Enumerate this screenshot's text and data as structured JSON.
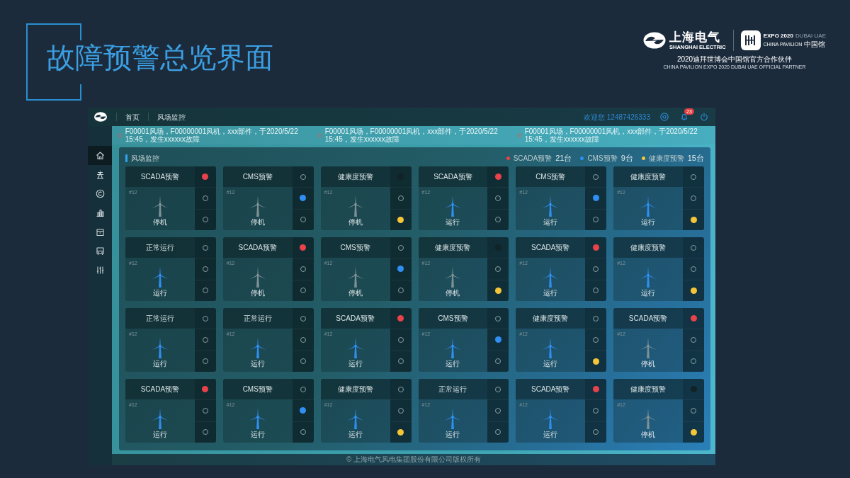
{
  "slide_title": "故障预警总览界面",
  "partner": {
    "brand_cn": "上海电气",
    "brand_en": "SHANGHAI ELECTRIC",
    "expo": "EXPO 2020",
    "expo_place": "DUBAI UAE",
    "pavilion_en": "CHINA PAVILION",
    "pavilion_cn": "中国馆",
    "caption_cn": "2020迪拜世博会中国馆官方合作伙伴",
    "caption_en": "CHINA PAVILION EXPO 2020 DUBAI UAE OFFICIAL PARTNER"
  },
  "app": {
    "nav": [
      "首页",
      "风场监控"
    ],
    "welcome": "欢迎您 12487426333",
    "notification_count": "23",
    "ticker": [
      "F00001风场，F00000001风机，xxx部件，于2020/5/22 15:45，发生xxxxxx故障",
      "F00001风场，F00000001风机，xxx部件，于2020/5/22 15:45，发生xxxxxx故障",
      "F00001风场，F00000001风机，xxx部件，于2020/5/22 15:45，发生xxxxxx故障"
    ],
    "sidebar": [
      {
        "selected": true
      },
      {
        "selected": false
      },
      {
        "selected": false
      },
      {
        "selected": false
      },
      {
        "selected": false
      },
      {
        "selected": false
      },
      {
        "selected": false
      }
    ],
    "panel": {
      "title": "风场监控",
      "legend": [
        {
          "label": "SCADA预警",
          "count": "21台",
          "color": "#e8424a"
        },
        {
          "label": "CMS预警",
          "count": "9台",
          "color": "#2f8ff2"
        },
        {
          "label": "健康度预警",
          "count": "15台",
          "color": "#f5c537"
        }
      ]
    },
    "turbines": [
      {
        "title": "SCADA预警",
        "number": "#12",
        "status": "停机",
        "running": false,
        "alerts": [
          {
            "on": true,
            "dimmed": false
          },
          {
            "on": false,
            "dimmed": false
          },
          {
            "on": false,
            "dimmed": false
          }
        ]
      },
      {
        "title": "CMS预警",
        "number": "#12",
        "status": "停机",
        "running": false,
        "alerts": [
          {
            "on": false,
            "dimmed": false
          },
          {
            "on": true,
            "dimmed": false
          },
          {
            "on": false,
            "dimmed": false
          }
        ]
      },
      {
        "title": "健康度预警",
        "number": "#12",
        "status": "停机",
        "running": false,
        "alerts": [
          {
            "on": false,
            "dimmed": true
          },
          {
            "on": false,
            "dimmed": false
          },
          {
            "on": true,
            "dimmed": false
          }
        ]
      },
      {
        "title": "SCADA预警",
        "number": "#12",
        "status": "运行",
        "running": true,
        "alerts": [
          {
            "on": true,
            "dimmed": false
          },
          {
            "on": false,
            "dimmed": false
          },
          {
            "on": false,
            "dimmed": false
          }
        ]
      },
      {
        "title": "CMS预警",
        "number": "#12",
        "status": "运行",
        "running": true,
        "alerts": [
          {
            "on": false,
            "dimmed": false
          },
          {
            "on": true,
            "dimmed": false
          },
          {
            "on": false,
            "dimmed": false
          }
        ]
      },
      {
        "title": "健康度预警",
        "number": "#12",
        "status": "运行",
        "running": true,
        "alerts": [
          {
            "on": false,
            "dimmed": false
          },
          {
            "on": false,
            "dimmed": false
          },
          {
            "on": true,
            "dimmed": false
          }
        ]
      },
      {
        "title": "正常运行",
        "number": "#12",
        "status": "运行",
        "running": true,
        "alerts": [
          {
            "on": false,
            "dimmed": false
          },
          {
            "on": false,
            "dimmed": false
          },
          {
            "on": false,
            "dimmed": false
          }
        ]
      },
      {
        "title": "SCADA预警",
        "number": "#12",
        "status": "停机",
        "running": false,
        "alerts": [
          {
            "on": true,
            "dimmed": false
          },
          {
            "on": false,
            "dimmed": false
          },
          {
            "on": false,
            "dimmed": false
          }
        ]
      },
      {
        "title": "CMS预警",
        "number": "#12",
        "status": "停机",
        "running": false,
        "alerts": [
          {
            "on": false,
            "dimmed": false
          },
          {
            "on": true,
            "dimmed": false
          },
          {
            "on": false,
            "dimmed": false
          }
        ]
      },
      {
        "title": "健康度预警",
        "number": "#12",
        "status": "停机",
        "running": false,
        "alerts": [
          {
            "on": false,
            "dimmed": true
          },
          {
            "on": false,
            "dimmed": false
          },
          {
            "on": true,
            "dimmed": false
          }
        ]
      },
      {
        "title": "SCADA预警",
        "number": "#12",
        "status": "运行",
        "running": true,
        "alerts": [
          {
            "on": true,
            "dimmed": false
          },
          {
            "on": false,
            "dimmed": false
          },
          {
            "on": false,
            "dimmed": false
          }
        ]
      },
      {
        "title": "健康度预警",
        "number": "#12",
        "status": "运行",
        "running": true,
        "alerts": [
          {
            "on": false,
            "dimmed": false
          },
          {
            "on": false,
            "dimmed": false
          },
          {
            "on": true,
            "dimmed": false
          }
        ]
      },
      {
        "title": "正常运行",
        "number": "#12",
        "status": "运行",
        "running": true,
        "alerts": [
          {
            "on": false,
            "dimmed": false
          },
          {
            "on": false,
            "dimmed": false
          },
          {
            "on": false,
            "dimmed": false
          }
        ]
      },
      {
        "title": "正常运行",
        "number": "#12",
        "status": "运行",
        "running": true,
        "alerts": [
          {
            "on": false,
            "dimmed": false
          },
          {
            "on": false,
            "dimmed": false
          },
          {
            "on": false,
            "dimmed": false
          }
        ]
      },
      {
        "title": "SCADA预警",
        "number": "#12",
        "status": "运行",
        "running": true,
        "alerts": [
          {
            "on": true,
            "dimmed": false
          },
          {
            "on": false,
            "dimmed": false
          },
          {
            "on": false,
            "dimmed": false
          }
        ]
      },
      {
        "title": "CMS预警",
        "number": "#12",
        "status": "运行",
        "running": true,
        "alerts": [
          {
            "on": false,
            "dimmed": false
          },
          {
            "on": true,
            "dimmed": false
          },
          {
            "on": false,
            "dimmed": false
          }
        ]
      },
      {
        "title": "健康度预警",
        "number": "#12",
        "status": "运行",
        "running": true,
        "alerts": [
          {
            "on": false,
            "dimmed": false
          },
          {
            "on": false,
            "dimmed": false
          },
          {
            "on": true,
            "dimmed": false
          }
        ]
      },
      {
        "title": "SCADA预警",
        "number": "#12",
        "status": "停机",
        "running": false,
        "alerts": [
          {
            "on": true,
            "dimmed": false
          },
          {
            "on": false,
            "dimmed": false
          },
          {
            "on": false,
            "dimmed": false
          }
        ]
      },
      {
        "title": "SCADA预警",
        "number": "#12",
        "status": "运行",
        "running": true,
        "alerts": [
          {
            "on": true,
            "dimmed": false
          },
          {
            "on": false,
            "dimmed": false
          },
          {
            "on": false,
            "dimmed": false
          }
        ]
      },
      {
        "title": "CMS预警",
        "number": "#12",
        "status": "运行",
        "running": true,
        "alerts": [
          {
            "on": false,
            "dimmed": false
          },
          {
            "on": true,
            "dimmed": false
          },
          {
            "on": false,
            "dimmed": false
          }
        ]
      },
      {
        "title": "健康度预警",
        "number": "#12",
        "status": "运行",
        "running": true,
        "alerts": [
          {
            "on": false,
            "dimmed": false
          },
          {
            "on": false,
            "dimmed": false
          },
          {
            "on": true,
            "dimmed": false
          }
        ]
      },
      {
        "title": "正常运行",
        "number": "#12",
        "status": "运行",
        "running": true,
        "alerts": [
          {
            "on": false,
            "dimmed": false
          },
          {
            "on": false,
            "dimmed": false
          },
          {
            "on": false,
            "dimmed": false
          }
        ]
      },
      {
        "title": "SCADA预警",
        "number": "#12",
        "status": "运行",
        "running": true,
        "alerts": [
          {
            "on": true,
            "dimmed": false
          },
          {
            "on": false,
            "dimmed": false
          },
          {
            "on": false,
            "dimmed": false
          }
        ]
      },
      {
        "title": "健康度预警",
        "number": "#12",
        "status": "停机",
        "running": false,
        "alerts": [
          {
            "on": false,
            "dimmed": true
          },
          {
            "on": false,
            "dimmed": false
          },
          {
            "on": true,
            "dimmed": false
          }
        ]
      }
    ],
    "footer": "© 上海电气风电集团股份有限公司版权所有"
  }
}
